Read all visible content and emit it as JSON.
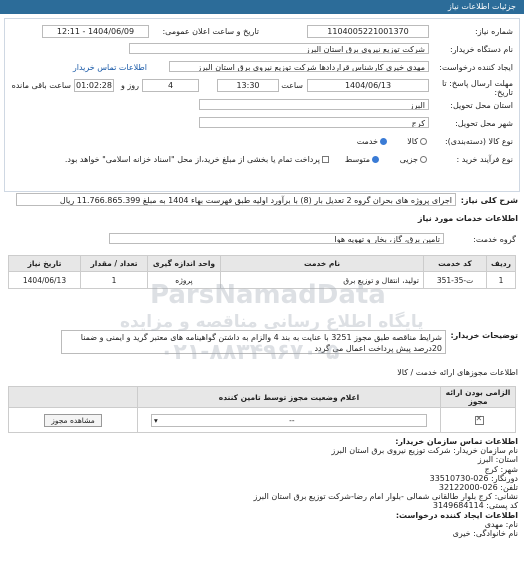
{
  "header": {
    "title": "جزئیات اطلاعات نیاز"
  },
  "need": {
    "number_label": "شماره نیاز:",
    "number": "1104005221001370",
    "announce_label": "تاریخ و ساعت اعلان عمومی:",
    "announce": "1404/06/09 - 12:11",
    "buyer_label": "نام دستگاه خریدار:",
    "buyer": "شرکت توزیع نیروی برق استان البرز",
    "creator_label": "ایجاد کننده درخواست:",
    "creator": "مهدی خیری کارشناس قراردادها شرکت توزیع نیروی برق استان البرز",
    "contact_link": "اطلاعات تماس خریدار",
    "deadline_label": "مهلت ارسال پاسخ: تا تاریخ:",
    "deadline_date": "1404/06/13",
    "time_label": "ساعت",
    "deadline_time": "13:30",
    "days": "4",
    "days_label": "روز و",
    "remaining": "01:02:28",
    "remaining_label": "ساعت باقی مانده",
    "province_label": "استان محل تحویل:",
    "province": "البرز",
    "city_label": "شهر محل تحویل:",
    "city": "کرج",
    "class_label": "نوع کالا (دسته‌بندی):",
    "class_opts": [
      "کالا",
      "خدمت"
    ],
    "process_label": "نوع فرآیند خرید :",
    "process_opts": [
      "جزیی",
      "متوسط"
    ],
    "payment_note": "پرداخت تمام یا بخشی از مبلغ خرید،از محل \"اسناد خزانه اسلامی\" خواهد بود."
  },
  "summary": {
    "label": "شرح کلی نیاز:",
    "text": "اجرای پروژه های بحران گروه 2 تعدیل بار (8) با برآورد اولیه طبق فهرست بهاء 1404 به مبلغ 11.766.865.399 ریال"
  },
  "services": {
    "title": "اطلاعات خدمات مورد نیاز",
    "group_label": "گروه خدمت:",
    "group": "تامین برق، گاز، بخار و تهویه هوا",
    "headers": [
      "ردیف",
      "کد خدمت",
      "نام خدمت",
      "واحد اندازه گیری",
      "تعداد / مقدار",
      "تاریخ نیاز"
    ],
    "rows": [
      [
        "1",
        "ت-35-351",
        "تولید، انتقال و توزیع برق",
        "پروژه",
        "1",
        "1404/06/13"
      ]
    ]
  },
  "notes": {
    "label": "توضیحات خریدار:",
    "text": "شرایط مناقصه طبق مجوز 3251 با عنایت به بند 4 والزام به داشتن گواهینامه های معتبر گرید و ایمنی و ضمنا 20درصد پیش پرداخت اعمال می گردد"
  },
  "permits": {
    "title": "اطلاعات مجوزهای ارائه خدمت / کالا",
    "headers": [
      "الزامی بودن ارائه مجوز",
      "اعلام وضعیت مجوز توسط تامین کننده",
      ""
    ],
    "status": "--",
    "view_button": "مشاهده مجوز"
  },
  "buyer_contact": {
    "title": "اطلاعات تماس سازمان خریدار:",
    "lines": [
      "نام سازمان خریدار: شرکت توزیع نیروی برق استان البرز",
      "استان: البرز",
      "شهر: کرج",
      "دورنگار: 026-33510730",
      "تلفن: 026-32122000",
      "نشانی: کرج بلوار طالقانی شمالی -بلوار امام رضا-شرکت توزیع برق استان البرز",
      "کد پستی: 3149684114",
      "اطلاعات ایجاد کننده درخواست:",
      "نام: مهدی",
      "نام خانوادگی: خیری"
    ]
  },
  "watermark": {
    "line1": "ParsNamadData",
    "line2": "پایگاه اطلاع رسانی مناقصه و مزایده",
    "phone": "۰۲۱-۸۸۳۴۹۶۷۰-۵"
  }
}
